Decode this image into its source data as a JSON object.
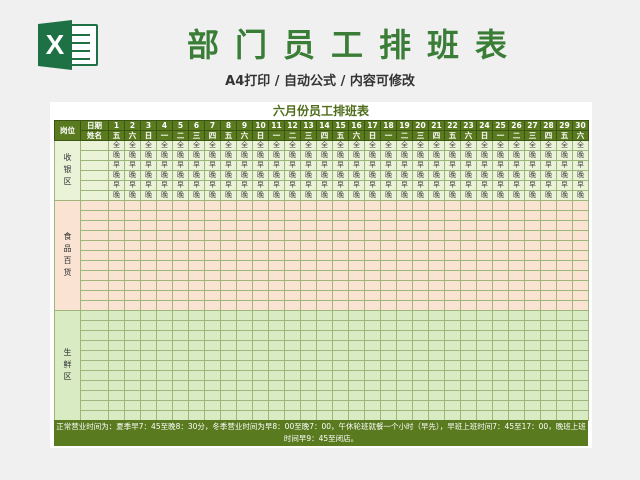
{
  "header": {
    "title": "部门员工排班表",
    "subtitle": "A4打印 / 自动公式 / 内容可修改",
    "logo_letter": "X"
  },
  "sheet": {
    "title": "六月份员工排班表",
    "col_position": "岗位",
    "col_date": "日期",
    "col_name": "姓名",
    "days": [
      "1",
      "2",
      "3",
      "4",
      "5",
      "6",
      "7",
      "8",
      "9",
      "10",
      "11",
      "12",
      "13",
      "14",
      "15",
      "16",
      "17",
      "18",
      "19",
      "20",
      "21",
      "22",
      "23",
      "24",
      "25",
      "26",
      "27",
      "28",
      "29",
      "30"
    ],
    "weekdays": [
      "五",
      "六",
      "日",
      "一",
      "二",
      "三",
      "四",
      "五",
      "六",
      "日",
      "一",
      "二",
      "三",
      "四",
      "五",
      "六",
      "日",
      "一",
      "二",
      "三",
      "四",
      "五",
      "六",
      "日",
      "一",
      "二",
      "三",
      "四",
      "五",
      "六"
    ],
    "groups": [
      {
        "name": "收银区",
        "shifts": [
          "全",
          "晚",
          "早",
          "晚",
          "早",
          "晚"
        ]
      },
      {
        "name": "食品百货",
        "rows": 11
      },
      {
        "name": "生鲜区",
        "rows": 11
      }
    ],
    "footer": "正常营业时间为：夏季早7：45至晚8：30分，冬季营业时间为早8：00至晚7：00，午休轮班就餐一个小时（早先），早班上班时间7：45至17：00，晚班上班时间早9：45至闭店。"
  },
  "colors": {
    "header_green": "#5a7a20",
    "title_green": "#3a7d36",
    "cashier_bg": "#eaf2d8",
    "food_bg": "#fbe3d3",
    "fresh_bg": "#d8ebc3"
  }
}
